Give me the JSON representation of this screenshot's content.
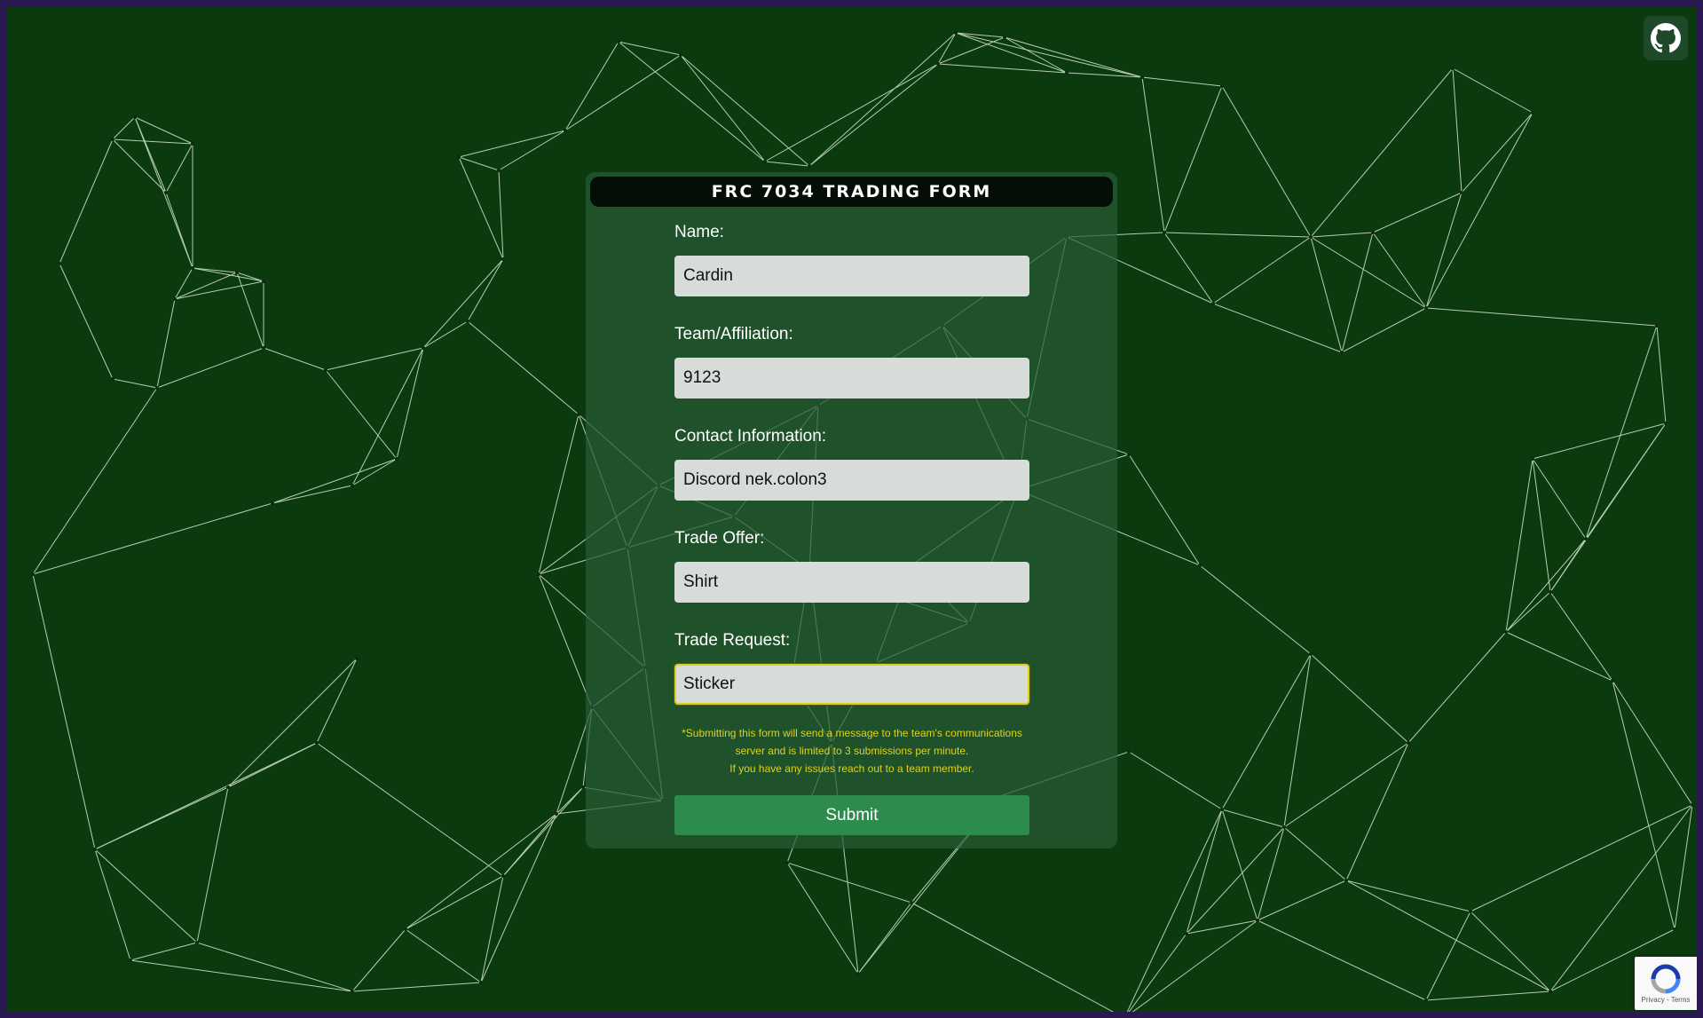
{
  "form": {
    "title": "FRC 7034 TRADING FORM",
    "fields": [
      {
        "label": "Name:",
        "value": "Cardin"
      },
      {
        "label": "Team/Affiliation:",
        "value": "9123"
      },
      {
        "label": "Contact Information:",
        "value": "Discord nek.colon3"
      },
      {
        "label": "Trade Offer:",
        "value": "Shirt"
      },
      {
        "label": "Trade Request:",
        "value": "Sticker"
      }
    ],
    "notice_line1": "*Submitting this form will send a message to the team's communications",
    "notice_line2": "server and is limited to 3 submissions per minute.",
    "notice_line3": "If you have any issues reach out to a team member.",
    "submit_label": "Submit"
  },
  "github": {
    "icon": "github-icon"
  },
  "recaptcha": {
    "links": "Privacy - Terms",
    "icon": "recaptcha-icon"
  },
  "colors": {
    "background": "#0a3a0d",
    "frame": "#2a1850",
    "card": "#285c37",
    "header": "#050d07",
    "submit": "#2e8b4e",
    "notice": "#e0d21a",
    "focus_border": "#d9d21a",
    "network_lines": "#d6e6d6"
  }
}
